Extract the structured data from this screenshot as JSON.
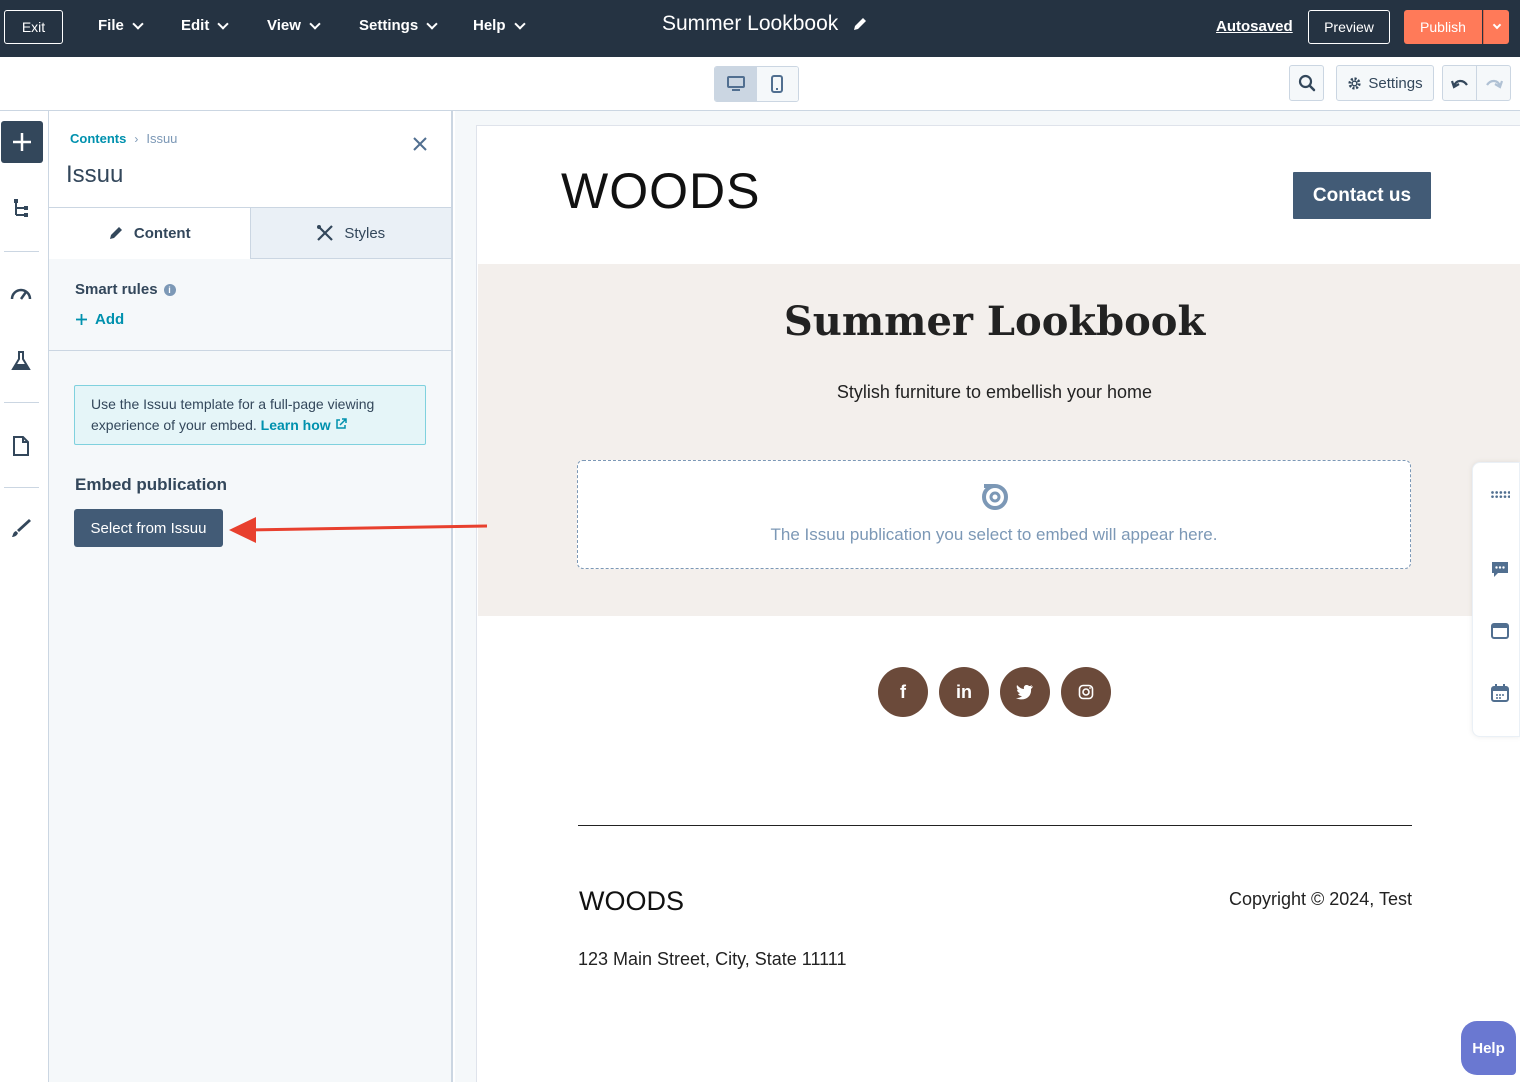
{
  "topbar": {
    "exit": "Exit",
    "menus": [
      "File",
      "Edit",
      "View",
      "Settings",
      "Help"
    ],
    "title": "Summer Lookbook",
    "autosaved": "Autosaved",
    "preview": "Preview",
    "publish": "Publish"
  },
  "toolbar": {
    "settings": "Settings"
  },
  "panel": {
    "breadcrumb_root": "Contents",
    "breadcrumb_sep": "›",
    "breadcrumb_current": "Issuu",
    "title": "Issuu",
    "tab_content": "Content",
    "tab_styles": "Styles",
    "smart_rules": "Smart rules",
    "add": "Add",
    "info_text": "Use the Issuu template for a full-page viewing experience of your embed.",
    "learn_how": "Learn how",
    "embed_label": "Embed publication",
    "select_button": "Select from Issuu"
  },
  "canvas": {
    "logo": "WOODS",
    "contact": "Contact us",
    "hero_title": "Summer Lookbook",
    "hero_sub": "Stylish furniture to embellish your home",
    "embed_placeholder": "The Issuu publication you select to embed will appear here.",
    "social": [
      "f",
      "in",
      "twitter",
      "instagram"
    ],
    "footer_logo": "WOODS",
    "copyright": "Copyright © 2024, Test",
    "address": "123 Main Street, City, State 11111"
  },
  "help": "Help",
  "colors": {
    "topbar": "#253342",
    "publish": "#ff7a59",
    "link": "#0091ae",
    "button_dark": "#425b76",
    "hero_bg": "#f3efec",
    "social_bg": "#6b4a3a",
    "arrow": "#e8402e",
    "help": "#6a78d1"
  }
}
